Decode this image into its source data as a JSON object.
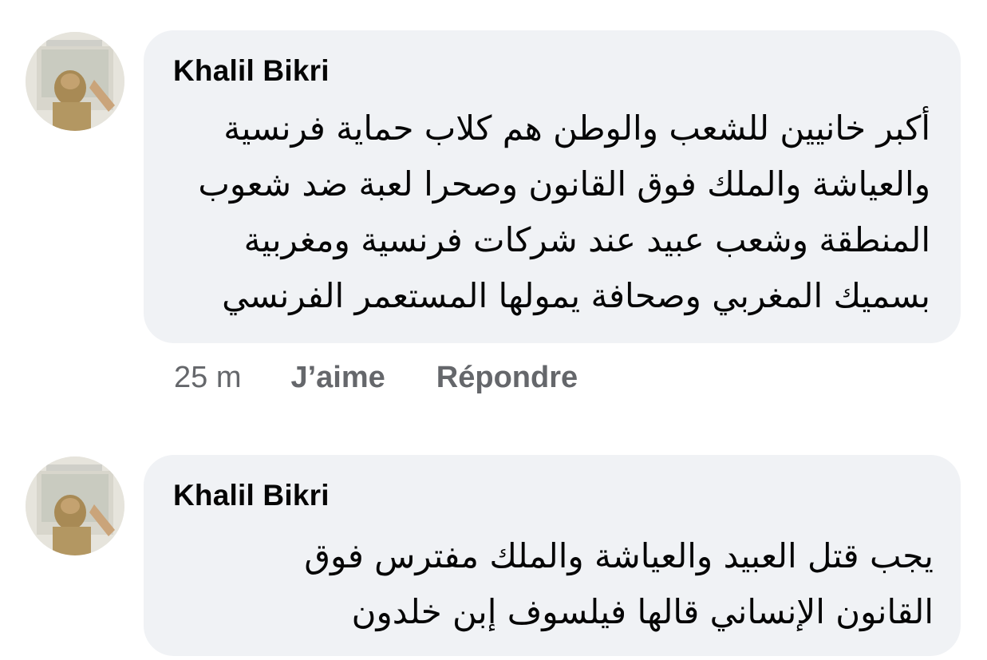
{
  "comments": [
    {
      "author": "Khalil Bikri",
      "lines": [
        "أكبر خانيين للشعب والوطن هم كلاب حماية فرنسية",
        "والعياشة والملك فوق القانون وصحرا لعبة ضد شعوب",
        "المنطقة وشعب عبيد عند شركات فرنسية ومغربية",
        "بسميك المغربي وصحافة يمولها المستعمر الفرنسي"
      ],
      "time": "25 m",
      "like_label": "J’aime",
      "reply_label": "Répondre"
    },
    {
      "author": "Khalil Bikri",
      "lines": [
        "يجب قتل العبيد والعياشة والملك مفترس فوق",
        "القانون الإنساني قالها فيلسوف إبن خلدون"
      ]
    }
  ],
  "colors": {
    "bubble": "#f0f2f5",
    "text": "#050505",
    "secondary": "#65676b"
  }
}
